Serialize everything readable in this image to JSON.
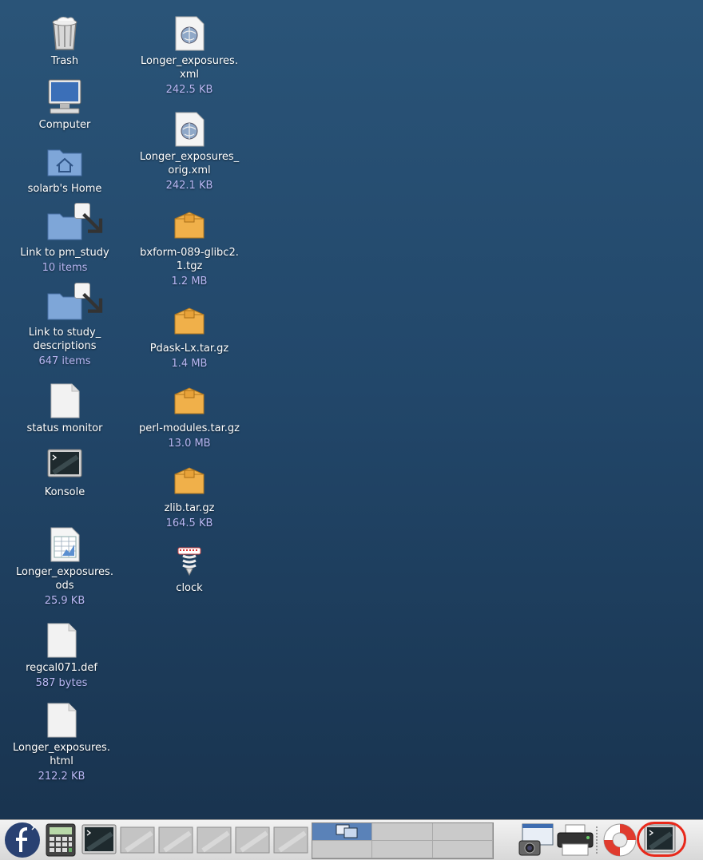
{
  "desktop_col1": [
    {
      "name": "trash",
      "label": "Trash",
      "sub": "",
      "icon": "trash-icon"
    },
    {
      "name": "computer",
      "label": "Computer",
      "sub": "",
      "icon": "computer-icon"
    },
    {
      "name": "home",
      "label": "solarb's Home",
      "sub": "",
      "icon": "home-folder-icon"
    },
    {
      "name": "link-pm-study",
      "label": "Link to pm_study",
      "sub": "10 items",
      "icon": "folder-link-icon"
    },
    {
      "name": "link-study-descriptions",
      "label": "Link to study_\ndescriptions",
      "sub": "647 items",
      "icon": "folder-link-icon"
    },
    {
      "name": "status-monitor",
      "label": "status monitor",
      "sub": "",
      "icon": "document-icon"
    },
    {
      "name": "konsole",
      "label": "Konsole",
      "sub": "",
      "icon": "terminal-icon"
    },
    {
      "name": "longer-exposures-ods",
      "label": "Longer_exposures.\nods",
      "sub": "25.9 KB",
      "icon": "spreadsheet-icon"
    },
    {
      "name": "regcal071-def",
      "label": "regcal071.def",
      "sub": "587 bytes",
      "icon": "document-icon"
    },
    {
      "name": "longer-exposures-html",
      "label": "Longer_exposures.\nhtml",
      "sub": "212.2 KB",
      "icon": "document-icon"
    }
  ],
  "desktop_col2": [
    {
      "name": "longer-exposures-xml",
      "label": "Longer_exposures.\nxml",
      "sub": "242.5 KB",
      "icon": "xml-file-icon"
    },
    {
      "name": "longer-exposures-orig-xml",
      "label": "Longer_exposures_\norig.xml",
      "sub": "242.1 KB",
      "icon": "xml-file-icon"
    },
    {
      "name": "bxform-tgz",
      "label": "bxform-089-glibc2.\n1.tgz",
      "sub": "1.2 MB",
      "icon": "archive-icon"
    },
    {
      "name": "pdask-tar-gz",
      "label": "Pdask-Lx.tar.gz",
      "sub": "1.4 MB",
      "icon": "archive-icon"
    },
    {
      "name": "perl-modules-tar-gz",
      "label": "perl-modules.tar.gz",
      "sub": "13.0 MB",
      "icon": "archive-icon"
    },
    {
      "name": "zlib-tar-gz",
      "label": "zlib.tar.gz",
      "sub": "164.5 KB",
      "icon": "archive-icon"
    },
    {
      "name": "clock",
      "label": "clock",
      "sub": "",
      "icon": "clock-icon"
    }
  ],
  "taskbar": {
    "items": [
      "fedora-logo-icon",
      "calculator-icon",
      "terminal-icon",
      "window-icon",
      "window-icon",
      "window-icon",
      "window-icon",
      "window-icon"
    ],
    "pager_workspaces": 6,
    "pager_active": 0,
    "tray": [
      "screenshot-icon",
      "printer-icon",
      "help-icon",
      "terminal-icon"
    ],
    "highlight_color": "#e8281a"
  }
}
